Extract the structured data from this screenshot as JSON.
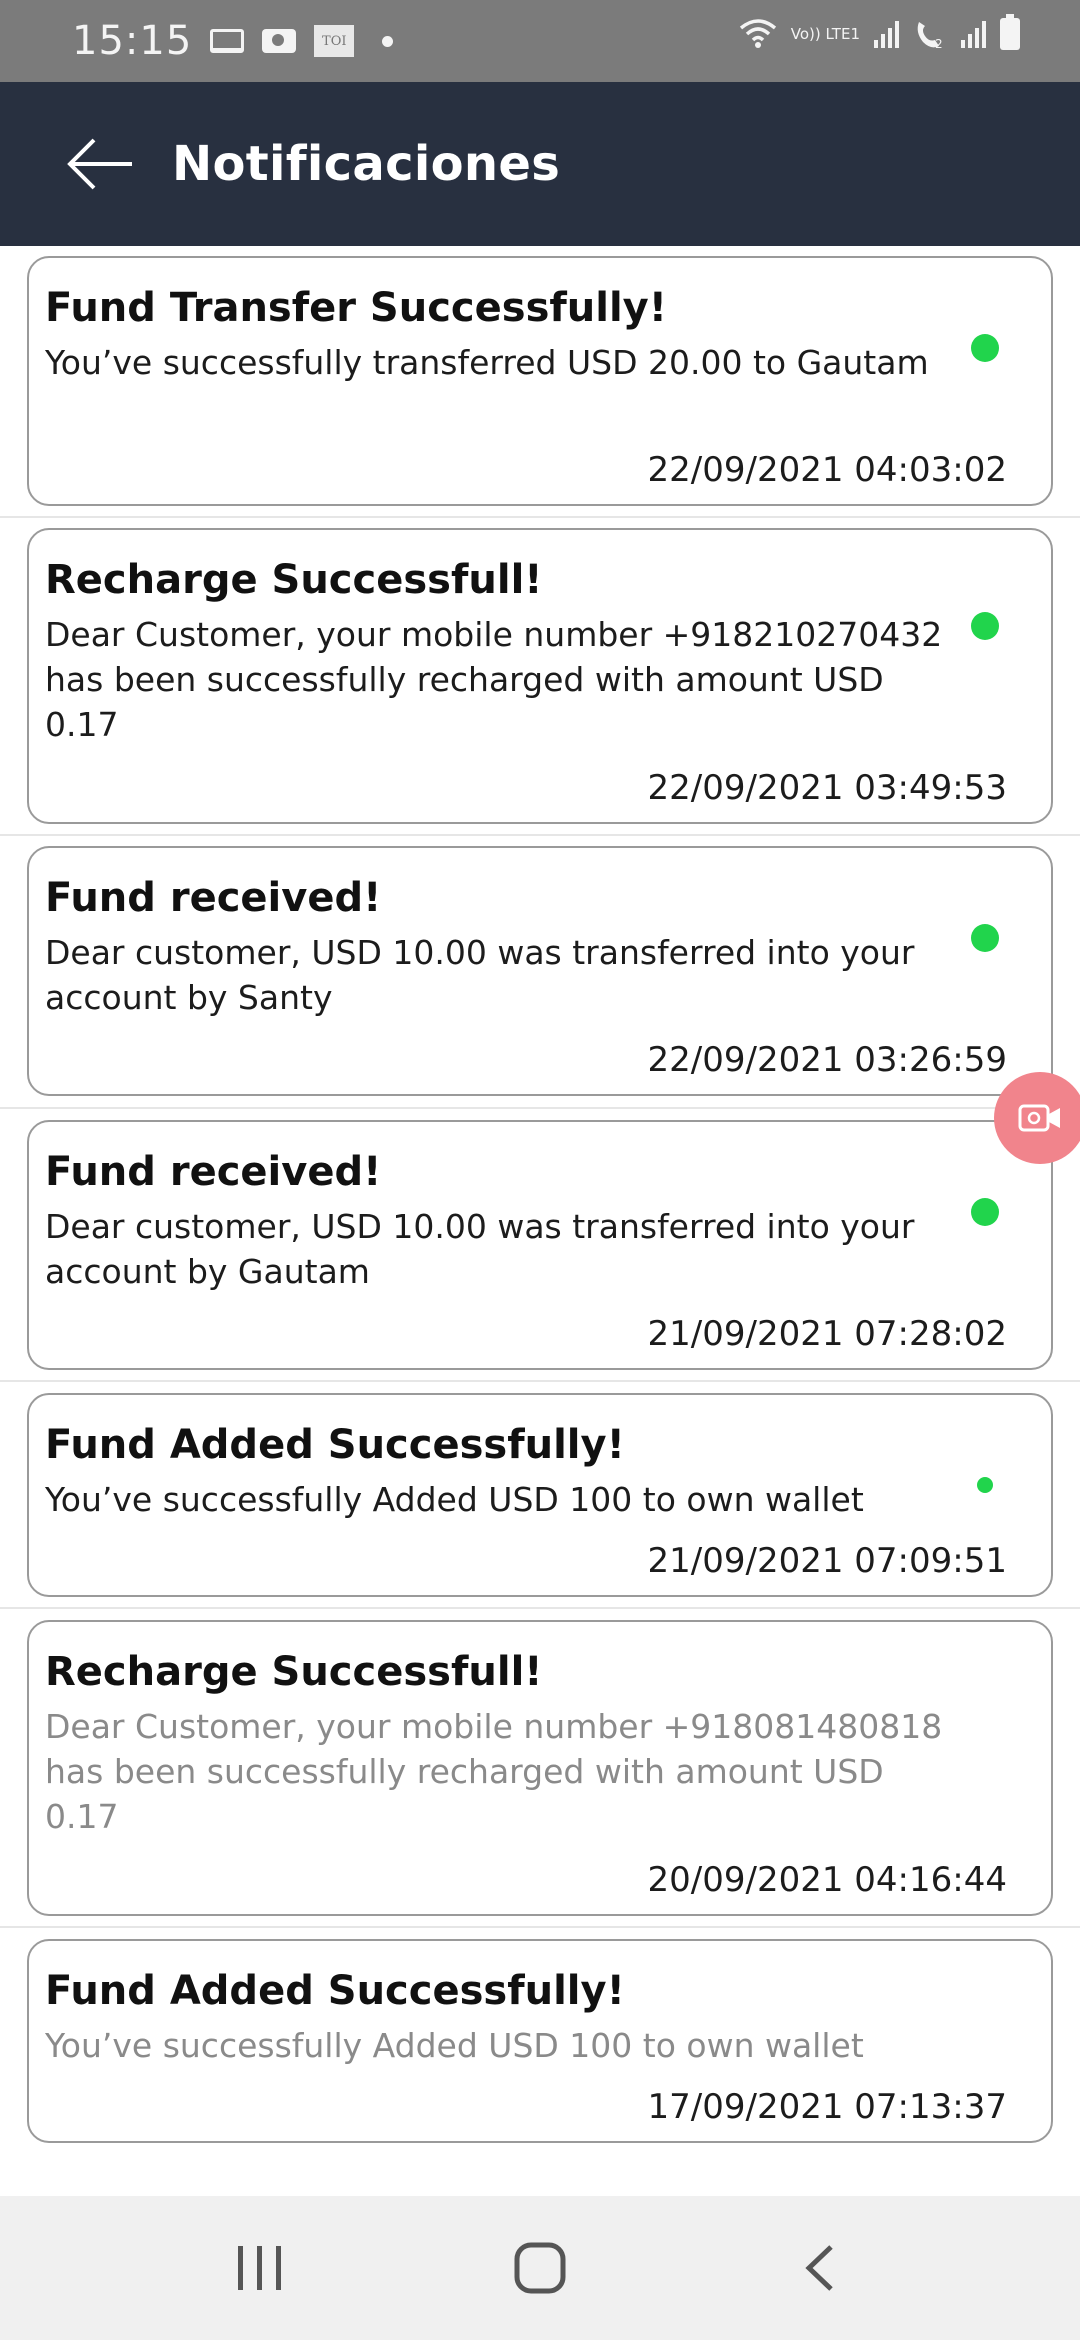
{
  "status_bar": {
    "time": "15:15",
    "toi_label": "TOI",
    "lte_label": "Vo)) LTE1",
    "colors": {
      "background": "#7b7b7b"
    },
    "icons": [
      "laptop-icon",
      "camera-icon",
      "toi-icon",
      "dot-icon",
      "wifi-icon",
      "signal-icon",
      "wifi-calling-icon",
      "battery-icon"
    ]
  },
  "header": {
    "title": "Notificaciones",
    "back_icon": "arrow-left-icon",
    "colors": {
      "background": "#283040",
      "text": "#ffffff"
    }
  },
  "notifications": [
    {
      "title": "Fund Transfer Successfully!",
      "message": "You’ve successfully transferred  USD 20.00  to Gautam",
      "timestamp": "22/09/2021 04:03:02",
      "unread": true
    },
    {
      "title": "Recharge Successfull!",
      "message": "Dear Customer, your mobile number +918210270432 has been successfully recharged with amount USD 0.17",
      "timestamp": "22/09/2021 03:49:53",
      "unread": true
    },
    {
      "title": "Fund received!",
      "message": "Dear customer, USD 10.00  was transferred into your account by Santy",
      "timestamp": "22/09/2021 03:26:59",
      "unread": true
    },
    {
      "title": "Fund received!",
      "message": "Dear customer, USD 10.00  was transferred into your account by Gautam",
      "timestamp": "21/09/2021 07:28:02",
      "unread": true
    },
    {
      "title": "Fund Added Successfully!",
      "message": "You’ve successfully Added USD 100  to own wallet",
      "timestamp": "21/09/2021 07:09:51",
      "unread": true
    },
    {
      "title": "Recharge Successfull!",
      "message": "Dear Customer, your mobile number +918081480818 has been successfully recharged with amount USD 0.17",
      "timestamp": "20/09/2021 04:16:44",
      "unread": false
    },
    {
      "title": "Fund Added Successfully!",
      "message": "You’ve successfully Added USD 100  to own wallet",
      "timestamp": "17/09/2021 07:13:37",
      "unread": false
    }
  ],
  "colors": {
    "unread_dot": "#21d44c",
    "read_text": "#8a8a8a",
    "recorder": "#f1848c"
  },
  "nav_bar": {
    "icons": [
      "recent-apps-icon",
      "home-icon",
      "back-icon"
    ]
  }
}
